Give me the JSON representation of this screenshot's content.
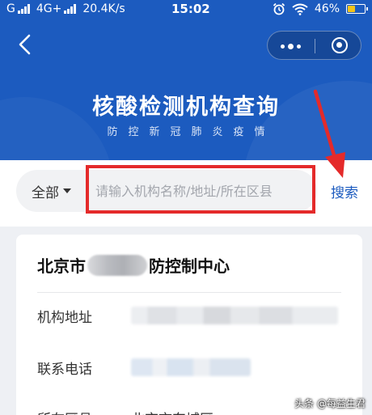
{
  "status_bar": {
    "carrier_left": "G",
    "network": "4G+",
    "speed": "20.4K/s",
    "time": "15:02",
    "battery": "46%",
    "battery_level": 0.46
  },
  "header": {
    "title": "核酸检测机构查询",
    "subtitle": "防控新冠肺炎疫情"
  },
  "search": {
    "filter_label": "全部",
    "placeholder": "请输入机构名称/地址/所在区县",
    "value": "",
    "button_label": "搜索"
  },
  "result_card": {
    "name_prefix": "北京市",
    "name_suffix": "防控制中心",
    "address_label": "机构地址",
    "phone_label": "联系电话",
    "district_label": "所在区县",
    "district_value": "北京市东城区"
  },
  "watermark": "头条 @每益生君",
  "colors": {
    "brand_blue": "#1c5bbf",
    "annotation_red": "#e42a2a"
  },
  "icons": [
    "back-icon",
    "more-icon",
    "target-icon",
    "caret-down-icon",
    "wifi-icon",
    "alarm-icon",
    "battery-icon"
  ]
}
